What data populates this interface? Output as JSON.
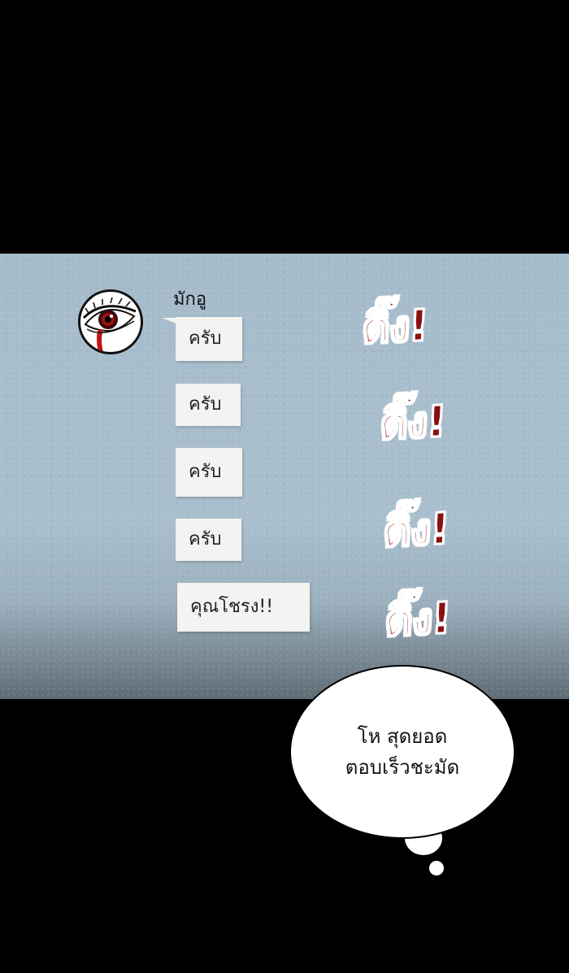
{
  "chat": {
    "sender_name": "มักอู",
    "messages": [
      "ครับ",
      "ครับ",
      "ครับ",
      "ครับ",
      "คุณโชรง!!"
    ]
  },
  "sound_effects": [
    "ติ๊ง!",
    "ติ๊ง!",
    "ติ๊ง!",
    "ติ๊ง!"
  ],
  "thought_bubble": {
    "text": "โห สุดยอด\nตอบเร็วชะมัด"
  },
  "icons": {
    "avatar": "crying-eye-avatar-icon"
  },
  "colors": {
    "panel_background": "#a6bccb",
    "sfx_red": "#8a1010",
    "bubble_white": "#f3f3f1"
  }
}
